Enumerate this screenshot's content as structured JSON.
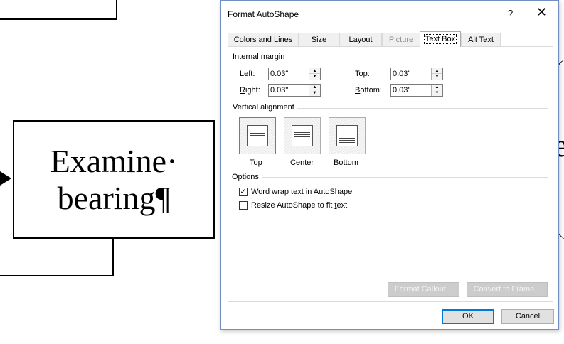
{
  "document": {
    "shape_text_line1": "Examine·",
    "shape_text_line2": "bearing¶",
    "background_letter": "e"
  },
  "dialog": {
    "title": "Format AutoShape",
    "help_glyph": "?",
    "close_glyph": "✕",
    "tabs": [
      {
        "label": "Colors and Lines",
        "state": "normal"
      },
      {
        "label": "Size",
        "state": "normal"
      },
      {
        "label": "Layout",
        "state": "normal"
      },
      {
        "label": "Picture",
        "state": "disabled"
      },
      {
        "label": "Text Box",
        "state": "active"
      },
      {
        "label": "Alt Text",
        "state": "normal"
      }
    ],
    "internal_margin": {
      "title": "Internal margin",
      "left": {
        "label_prefix": "",
        "label_access": "L",
        "label_rest": "eft:",
        "value": "0.03\""
      },
      "right": {
        "label_prefix": "",
        "label_access": "R",
        "label_rest": "ight:",
        "value": "0.03\""
      },
      "top": {
        "label_prefix": "T",
        "label_access": "o",
        "label_rest": "p:",
        "value": "0.03\""
      },
      "bottom": {
        "label_prefix": "",
        "label_access": "B",
        "label_rest": "ottom:",
        "value": "0.03\""
      }
    },
    "vertical_alignment": {
      "title": "Vertical alignment",
      "options": [
        {
          "label_prefix": "To",
          "label_access": "p",
          "label_rest": "",
          "selected": true
        },
        {
          "label_prefix": "",
          "label_access": "C",
          "label_rest": "enter",
          "selected": false
        },
        {
          "label_prefix": "Botto",
          "label_access": "m",
          "label_rest": "",
          "selected": false
        }
      ]
    },
    "options": {
      "title": "Options",
      "word_wrap": {
        "label_prefix": "",
        "label_access": "W",
        "label_rest": "ord wrap text in AutoShape",
        "checked": true,
        "check_glyph": "✓"
      },
      "resize": {
        "label_prefix": "Resize AutoShape to fit ",
        "label_access": "t",
        "label_rest": "ext",
        "checked": false
      }
    },
    "buttons": {
      "format_callout": "Format Callout...",
      "convert_to_frame": "Convert to Frame...",
      "ok": "OK",
      "cancel": "Cancel"
    },
    "colors": {
      "accent": "#0078d7",
      "border": "#6f8fc2"
    }
  }
}
